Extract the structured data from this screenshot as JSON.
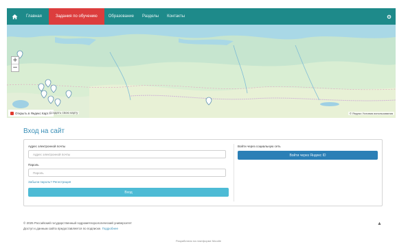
{
  "navbar": {
    "items": [
      "Главная",
      "Задания по обучению",
      "Образование",
      "Разделы",
      "Контакты"
    ],
    "active_index": 1,
    "home_icon": "home-icon",
    "right_icon": "gear-icon",
    "bg_color": "#1e8a8a",
    "active_color": "#dc3d3d"
  },
  "map": {
    "zoom_in": "+",
    "zoom_out": "−",
    "open_in_maps": "Открыть в Яндекс Картах",
    "create_map": "Создать свою карту",
    "copyright": "© Яндекс  Условия использования"
  },
  "login": {
    "title": "Вход на сайт",
    "email_label": "Адрес электронной почты",
    "email_placeholder": "Адрес электронной почты",
    "password_label": "Пароль",
    "password_placeholder": "Пароль",
    "forgot_link": "Забыли пароль? Регистрация",
    "submit_label": "Вход",
    "alt_heading": "Войти через социальную сеть",
    "alt_button": "Войти через Яндекс ID"
  },
  "footer": {
    "line1": "© 2025 Российский государственный гидрометеорологический университет",
    "line2_text": "Доступ к данным сайта предоставляется по подписке.",
    "line2_link": "Подробнее",
    "bottom": "Разработано на платформе Moodle"
  }
}
